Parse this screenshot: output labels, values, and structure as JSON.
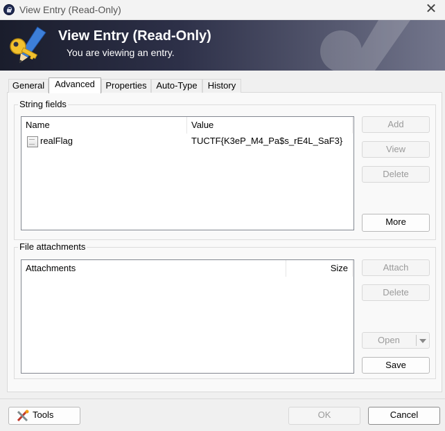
{
  "window": {
    "title": "View Entry (Read-Only)",
    "close_glyph": "✕"
  },
  "banner": {
    "title": "View Entry (Read-Only)",
    "subtitle": "You are viewing an entry."
  },
  "tabs": [
    {
      "label": "General",
      "active": false
    },
    {
      "label": "Advanced",
      "active": true
    },
    {
      "label": "Properties",
      "active": false
    },
    {
      "label": "Auto-Type",
      "active": false
    },
    {
      "label": "History",
      "active": false
    }
  ],
  "string_fields": {
    "group_label": "String fields",
    "columns": {
      "name": "Name",
      "value": "Value"
    },
    "rows": [
      {
        "name": "realFlag",
        "value": "TUCTF{K3eP_M4_Pa$s_rE4L_SaF3}"
      }
    ],
    "buttons": {
      "add": "Add",
      "view": "View",
      "delete": "Delete",
      "more": "More"
    }
  },
  "file_attachments": {
    "group_label": "File attachments",
    "columns": {
      "attachments": "Attachments",
      "size": "Size"
    },
    "buttons": {
      "attach": "Attach",
      "delete": "Delete",
      "open": "Open",
      "save": "Save"
    }
  },
  "footer": {
    "tools": "Tools",
    "ok": "OK",
    "cancel": "Cancel"
  },
  "icons": {
    "app": "padlock-icon",
    "banner": "key-pencil-icon",
    "doc": "document-icon",
    "tools": "tools-icon",
    "dropdown": "chevron-down-icon"
  },
  "colors": {
    "banner_dark": "#1a1d2c",
    "banner_light": "#73768c",
    "key_gold": "#f2c12e",
    "pencil_blue": "#3d7fd9"
  }
}
